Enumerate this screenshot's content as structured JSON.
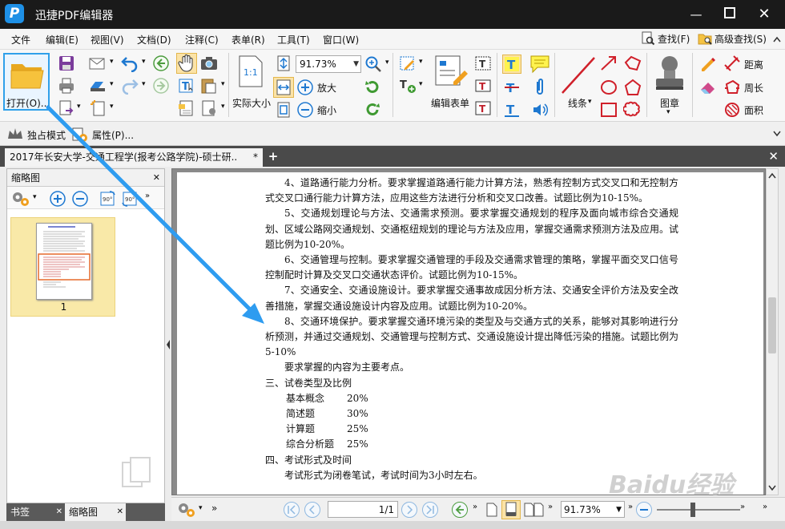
{
  "window": {
    "title": "迅捷PDF编辑器",
    "logo": "P"
  },
  "menu": {
    "items": [
      "文件",
      "编辑(E)",
      "视图(V)",
      "文档(D)",
      "注释(C)",
      "表单(R)",
      "工具(T)",
      "窗口(W)"
    ],
    "find": "查找(F)",
    "advanced_find": "高级查找(S)"
  },
  "ribbon": {
    "open_label": "打开(O)...",
    "zoom_value": "91.73%",
    "actual_size_label": "实际大小",
    "zoom_in_label": "放大",
    "zoom_out_label": "缩小",
    "edit_form_label": "编辑表单",
    "line_label": "线条",
    "stamp_label": "图章",
    "distance_label": "距离",
    "perimeter_label": "周长",
    "area_label": "面积"
  },
  "toolbar2": {
    "exclusive_mode": "独占模式",
    "properties": "属性(P)..."
  },
  "tab": {
    "title": "2017年长安大学-交通工程学(报考公路学院)-硕士研..",
    "modified": "*"
  },
  "left_panel": {
    "title": "缩略图",
    "page_number": "1",
    "tabs": [
      "书签",
      "缩略图"
    ]
  },
  "document": {
    "paragraphs": [
      "4、道路通行能力分析。要求掌握道路通行能力计算方法，熟悉有控制方式交叉口和无控制方式交叉口通行能力计算方法，应用这些方法进行分析和交叉口改善。试题比例为10-15%。",
      "5、交通规划理论与方法、交通需求预测。要求掌握交通规划的程序及面向城市综合交通规划、区域公路网交通规划、交通枢纽规划的理论与方法及应用，掌握交通需求预测方法及应用。试题比例为10-20%。",
      "6、交通管理与控制。要求掌握交通管理的手段及交通需求管理的策略，掌握平面交叉口信号控制配时计算及交叉口交通状态评价。试题比例为10-15%。",
      "7、交通安全、交通设施设计。要求掌握交通事故成因分析方法、交通安全评价方法及安全改善措施，掌握交通设施设计内容及应用。试题比例为10-20%。",
      "8、交通环境保护。要求掌握交通环境污染的类型及与交通方式的关系，能够对其影响进行分析预测，并通过交通规划、交通管理与控制方式、交通设施设计提出降低污染的措施。试题比例为5-10%"
    ],
    "key_points": "要求掌握的内容为主要考点。",
    "section3": "三、试卷类型及比例",
    "ratios": [
      {
        "type": "基本概念",
        "pct": "20%"
      },
      {
        "type": "简述题",
        "pct": "30%"
      },
      {
        "type": "计算题",
        "pct": "25%"
      },
      {
        "type": "综合分析题",
        "pct": "25%"
      }
    ],
    "section4": "四、考试形式及时间",
    "exam_form": "考试形式为闭卷笔试，考试时间为3小时左右。"
  },
  "navbar": {
    "page_display": "1/1",
    "zoom_value": "91.73%"
  },
  "watermark": "Baidu经验",
  "colors": {
    "accent": "#2fa0ea",
    "arrow": "#2e9cf0",
    "titlebar": "#1a1a1a",
    "selection": "#f9e9a8"
  }
}
